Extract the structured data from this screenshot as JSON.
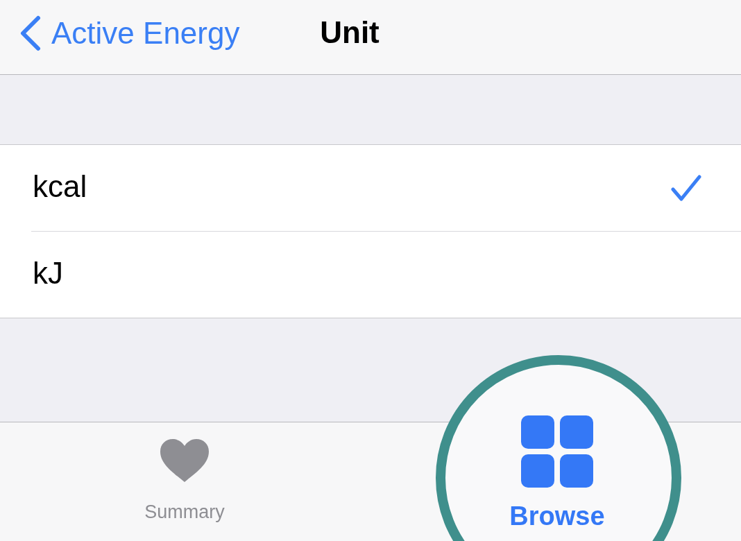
{
  "nav": {
    "back_label": "Active Energy",
    "title": "Unit"
  },
  "units": [
    {
      "label": "kcal",
      "selected": true
    },
    {
      "label": "kJ",
      "selected": false
    }
  ],
  "tab_bar": [
    {
      "label": "Summary",
      "kind": "heart",
      "selected": false
    },
    {
      "label": "Browse",
      "kind": "grid",
      "selected": true
    }
  ]
}
